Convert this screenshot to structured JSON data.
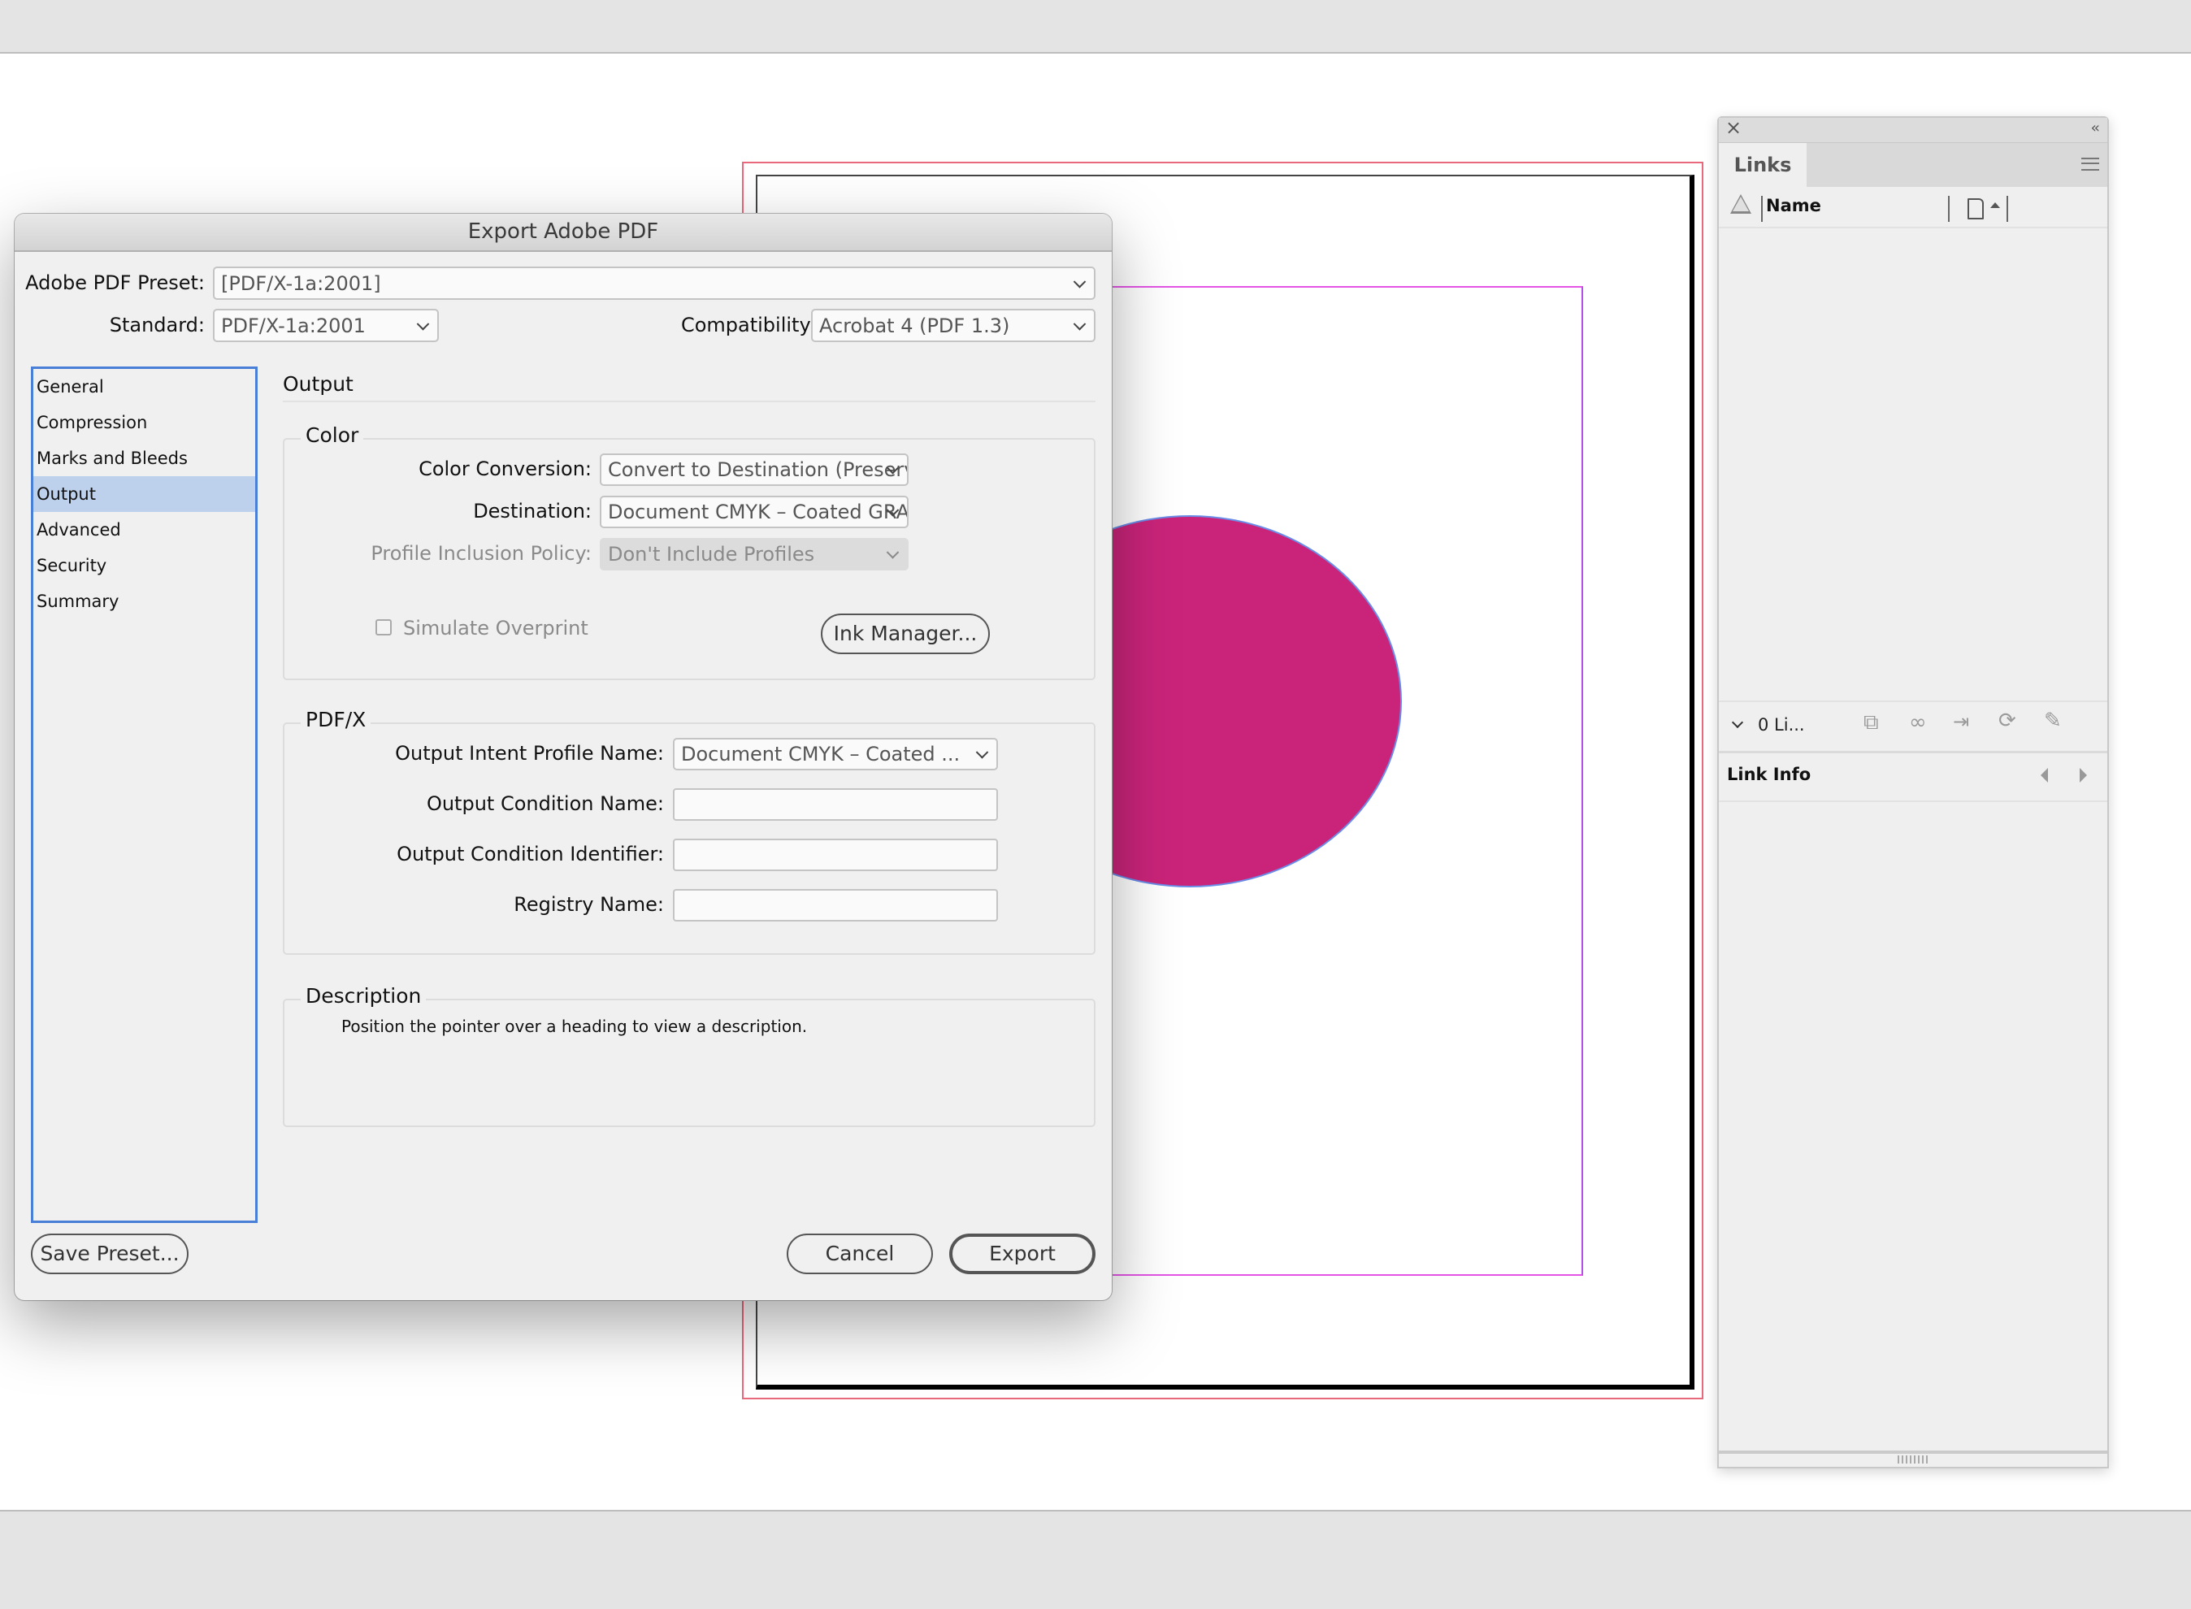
{
  "app": {
    "document": {
      "shape": "ellipse",
      "shape_color": "#ca247a",
      "bleed_color": "#e8697c",
      "margin_color": "#e455e6"
    }
  },
  "dialog": {
    "title": "Export Adobe PDF",
    "preset_label": "Adobe PDF Preset:",
    "preset_value": "[PDF/X-1a:2001]",
    "standard_label": "Standard:",
    "standard_value": "PDF/X-1a:2001",
    "compatibility_label": "Compatibility:",
    "compatibility_value": "Acrobat 4 (PDF 1.3)",
    "sidebar": {
      "items": [
        {
          "label": "General",
          "selected": false
        },
        {
          "label": "Compression",
          "selected": false
        },
        {
          "label": "Marks and Bleeds",
          "selected": false
        },
        {
          "label": "Output",
          "selected": true
        },
        {
          "label": "Advanced",
          "selected": false
        },
        {
          "label": "Security",
          "selected": false
        },
        {
          "label": "Summary",
          "selected": false
        }
      ]
    },
    "panel_title": "Output",
    "color_group": {
      "legend": "Color",
      "color_conversion_label": "Color Conversion:",
      "color_conversion_value": "Convert to Destination (Preserve N...",
      "destination_label": "Destination:",
      "destination_value": "Document CMYK – Coated GRACoL...",
      "profile_policy_label": "Profile Inclusion Policy:",
      "profile_policy_value": "Don't Include Profiles",
      "simulate_overprint_label": "Simulate Overprint",
      "simulate_overprint_checked": false,
      "ink_manager_label": "Ink Manager..."
    },
    "pdfx_group": {
      "legend": "PDF/X",
      "output_intent_label": "Output Intent Profile Name:",
      "output_intent_value": "Document CMYK – Coated ...",
      "condition_name_label": "Output Condition Name:",
      "condition_name_value": "",
      "condition_identifier_label": "Output Condition Identifier:",
      "condition_identifier_value": "",
      "registry_name_label": "Registry Name:",
      "registry_name_value": ""
    },
    "description_group": {
      "legend": "Description",
      "text": "Position the pointer over a heading to view a description."
    },
    "buttons": {
      "save_preset": "Save Preset...",
      "cancel": "Cancel",
      "export": "Export"
    }
  },
  "links_panel": {
    "tab_label": "Links",
    "column_name": "Name",
    "count_label": "0 Li...",
    "link_info_label": "Link Info"
  }
}
